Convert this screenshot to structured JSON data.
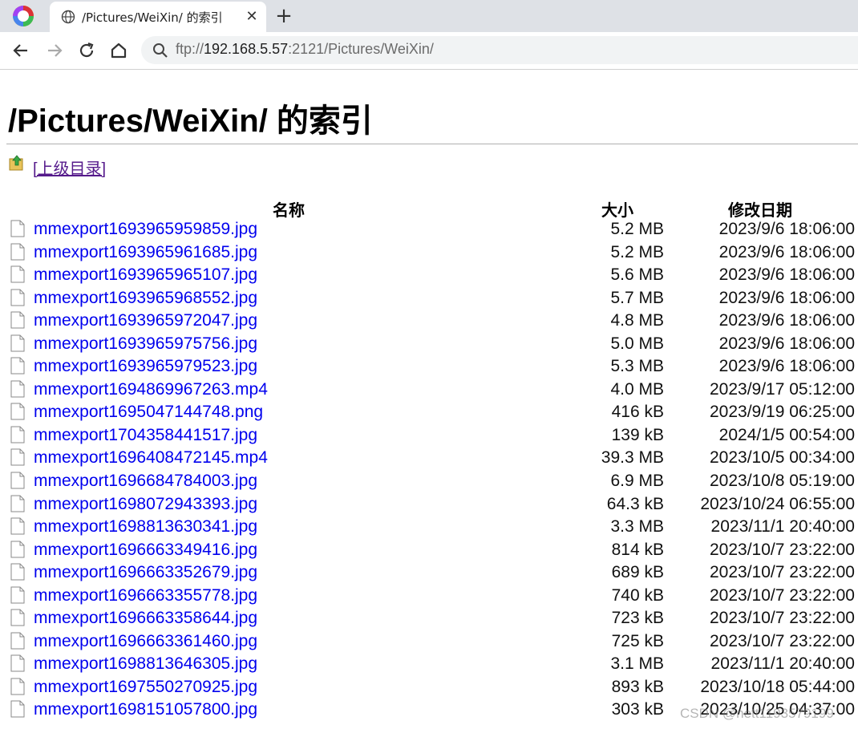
{
  "browser": {
    "tab_title": "/Pictures/WeiXin/ 的索引",
    "new_tab_symbol": "+",
    "close_symbol": "✕",
    "url_scheme": "ftp://",
    "url_host": "192.168.5.57",
    "url_rest": ":2121/Pictures/WeiXin/"
  },
  "page": {
    "title": "/Pictures/WeiXin/ 的索引",
    "parent_link": "[上级目录]",
    "columns": {
      "name": "名称",
      "size": "大小",
      "date": "修改日期"
    },
    "files": [
      {
        "name": "mmexport1693965959859.jpg",
        "size": "5.2 MB",
        "date": "2023/9/6 18:06:00"
      },
      {
        "name": "mmexport1693965961685.jpg",
        "size": "5.2 MB",
        "date": "2023/9/6 18:06:00"
      },
      {
        "name": "mmexport1693965965107.jpg",
        "size": "5.6 MB",
        "date": "2023/9/6 18:06:00"
      },
      {
        "name": "mmexport1693965968552.jpg",
        "size": "5.7 MB",
        "date": "2023/9/6 18:06:00"
      },
      {
        "name": "mmexport1693965972047.jpg",
        "size": "4.8 MB",
        "date": "2023/9/6 18:06:00"
      },
      {
        "name": "mmexport1693965975756.jpg",
        "size": "5.0 MB",
        "date": "2023/9/6 18:06:00"
      },
      {
        "name": "mmexport1693965979523.jpg",
        "size": "5.3 MB",
        "date": "2023/9/6 18:06:00"
      },
      {
        "name": "mmexport1694869967263.mp4",
        "size": "4.0 MB",
        "date": "2023/9/17 05:12:00"
      },
      {
        "name": "mmexport1695047144748.png",
        "size": "416 kB",
        "date": "2023/9/19 06:25:00"
      },
      {
        "name": "mmexport1704358441517.jpg",
        "size": "139 kB",
        "date": "2024/1/5 00:54:00"
      },
      {
        "name": "mmexport1696408472145.mp4",
        "size": "39.3 MB",
        "date": "2023/10/5 00:34:00"
      },
      {
        "name": "mmexport1696684784003.jpg",
        "size": "6.9 MB",
        "date": "2023/10/8 05:19:00"
      },
      {
        "name": "mmexport1698072943393.jpg",
        "size": "64.3 kB",
        "date": "2023/10/24 06:55:00"
      },
      {
        "name": "mmexport1698813630341.jpg",
        "size": "3.3 MB",
        "date": "2023/11/1 20:40:00"
      },
      {
        "name": "mmexport1696663349416.jpg",
        "size": "814 kB",
        "date": "2023/10/7 23:22:00"
      },
      {
        "name": "mmexport1696663352679.jpg",
        "size": "689 kB",
        "date": "2023/10/7 23:22:00"
      },
      {
        "name": "mmexport1696663355778.jpg",
        "size": "740 kB",
        "date": "2023/10/7 23:22:00"
      },
      {
        "name": "mmexport1696663358644.jpg",
        "size": "723 kB",
        "date": "2023/10/7 23:22:00"
      },
      {
        "name": "mmexport1696663361460.jpg",
        "size": "725 kB",
        "date": "2023/10/7 23:22:00"
      },
      {
        "name": "mmexport1698813646305.jpg",
        "size": "3.1 MB",
        "date": "2023/11/1 20:40:00"
      },
      {
        "name": "mmexport1697550270925.jpg",
        "size": "893 kB",
        "date": "2023/10/18 05:44:00"
      },
      {
        "name": "mmexport1698151057800.jpg",
        "size": "303 kB",
        "date": "2023/10/25 04:37:00"
      }
    ]
  },
  "watermark": "CSDN @nett1193579199"
}
